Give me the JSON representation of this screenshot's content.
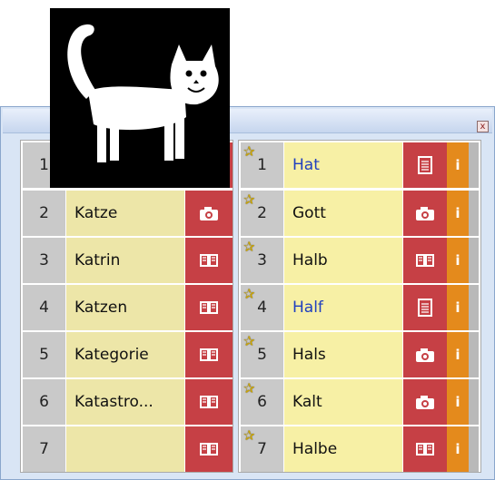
{
  "window": {
    "close_label": "x"
  },
  "left_list": [
    {
      "number": "1",
      "word": "",
      "media": ""
    },
    {
      "number": "2",
      "word": "Katze",
      "media": "camera-icon"
    },
    {
      "number": "3",
      "word": "Katrin",
      "media": "book-icon"
    },
    {
      "number": "4",
      "word": "Katzen",
      "media": "book-icon"
    },
    {
      "number": "5",
      "word": "Kategorie",
      "media": "book-icon"
    },
    {
      "number": "6",
      "word": "Katastro...",
      "media": "book-icon"
    },
    {
      "number": "7",
      "word": "",
      "media": "book-icon"
    }
  ],
  "right_list": [
    {
      "number": "1",
      "word": "Hat",
      "word_color": "#1f3fbf",
      "media": "document-icon",
      "info": "i"
    },
    {
      "number": "2",
      "word": "Gott",
      "word_color": "#111111",
      "media": "camera-icon",
      "info": "i"
    },
    {
      "number": "3",
      "word": "Halb",
      "word_color": "#111111",
      "media": "book-icon",
      "info": "i"
    },
    {
      "number": "4",
      "word": "Half",
      "word_color": "#1f3fbf",
      "media": "document-icon",
      "info": "i"
    },
    {
      "number": "5",
      "word": "Hals",
      "word_color": "#111111",
      "media": "camera-icon",
      "info": "i"
    },
    {
      "number": "6",
      "word": "Kalt",
      "word_color": "#111111",
      "media": "camera-icon",
      "info": "i"
    },
    {
      "number": "7",
      "word": "Halbe",
      "word_color": "#111111",
      "media": "book-icon",
      "info": "i"
    }
  ],
  "colors": {
    "media_red": "#c64045",
    "info_orange": "#e48a1c",
    "word_left": "#ede6a8",
    "word_right": "#f7f0a5",
    "number_gray": "#c9c9c9"
  },
  "image": {
    "icon": "cat-icon"
  }
}
